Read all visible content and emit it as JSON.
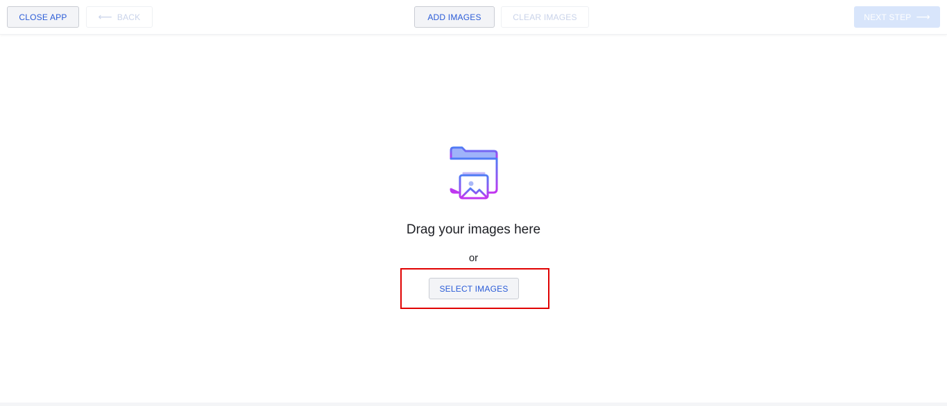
{
  "toolbar": {
    "close_app_label": "CLOSE APP",
    "back_label": "BACK",
    "add_images_label": "ADD IMAGES",
    "clear_images_label": "CLEAR IMAGES",
    "next_step_label": "NEXT STEP"
  },
  "drop_zone": {
    "icon": "folder-image-icon",
    "drag_text": "Drag your images here",
    "or_text": "or",
    "select_images_label": "SELECT IMAGES"
  },
  "colors": {
    "accent": "#2a5bd7",
    "disabled_text": "#c9d3ea",
    "primary_disabled_bg": "#d8e5fb",
    "highlight": "#e00000",
    "icon_gradient_start": "#4f7cf5",
    "icon_gradient_end": "#c235f0"
  }
}
